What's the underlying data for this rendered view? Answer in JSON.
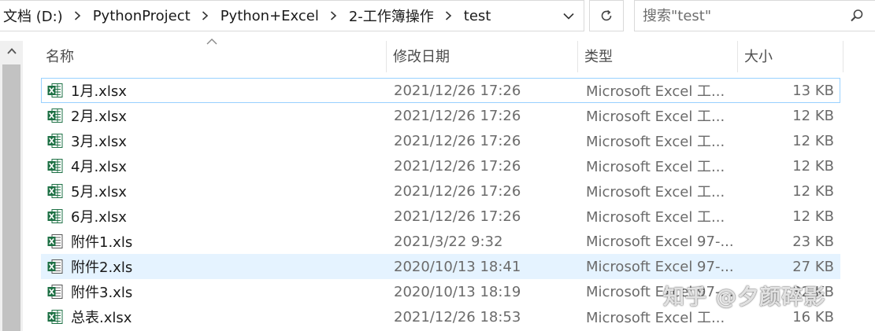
{
  "address_bar": {
    "crumbs": [
      "文档 (D:)",
      "PythonProject",
      "Python+Excel",
      "2-工作簿操作",
      "test"
    ]
  },
  "search": {
    "placeholder": "搜索\"test\""
  },
  "columns": {
    "name": "名称",
    "date": "修改日期",
    "type": "类型",
    "size": "大小"
  },
  "files": [
    {
      "name": "1月.xlsx",
      "date": "2021/12/26 17:26",
      "type": "Microsoft Excel 工...",
      "size": "13 KB",
      "icon": "xlsx-icon"
    },
    {
      "name": "2月.xlsx",
      "date": "2021/12/26 17:26",
      "type": "Microsoft Excel 工...",
      "size": "12 KB",
      "icon": "xlsx-icon"
    },
    {
      "name": "3月.xlsx",
      "date": "2021/12/26 17:26",
      "type": "Microsoft Excel 工...",
      "size": "12 KB",
      "icon": "xlsx-icon"
    },
    {
      "name": "4月.xlsx",
      "date": "2021/12/26 17:26",
      "type": "Microsoft Excel 工...",
      "size": "12 KB",
      "icon": "xlsx-icon"
    },
    {
      "name": "5月.xlsx",
      "date": "2021/12/26 17:26",
      "type": "Microsoft Excel 工...",
      "size": "12 KB",
      "icon": "xlsx-icon"
    },
    {
      "name": "6月.xlsx",
      "date": "2021/12/26 17:26",
      "type": "Microsoft Excel 工...",
      "size": "12 KB",
      "icon": "xlsx-icon"
    },
    {
      "name": "附件1.xls",
      "date": "2021/3/22 9:32",
      "type": "Microsoft Excel 97-...",
      "size": "23 KB",
      "icon": "xls-icon"
    },
    {
      "name": "附件2.xls",
      "date": "2020/10/13 18:41",
      "type": "Microsoft Excel 97-...",
      "size": "27 KB",
      "icon": "xls-icon"
    },
    {
      "name": "附件3.xls",
      "date": "2020/10/13 18:19",
      "type": "Microsoft Excel 97-...",
      "size": "32 KB",
      "icon": "xls-icon"
    },
    {
      "name": "总表.xlsx",
      "date": "2021/12/26 18:53",
      "type": "Microsoft Excel 工...",
      "size": "16 KB",
      "icon": "xlsx-icon"
    }
  ],
  "watermark": "知乎 @夕颜碎影",
  "colors": {
    "excel_green": "#1d7044",
    "selection_hover": "#e5f3ff",
    "focus_border": "#99d1ff"
  }
}
